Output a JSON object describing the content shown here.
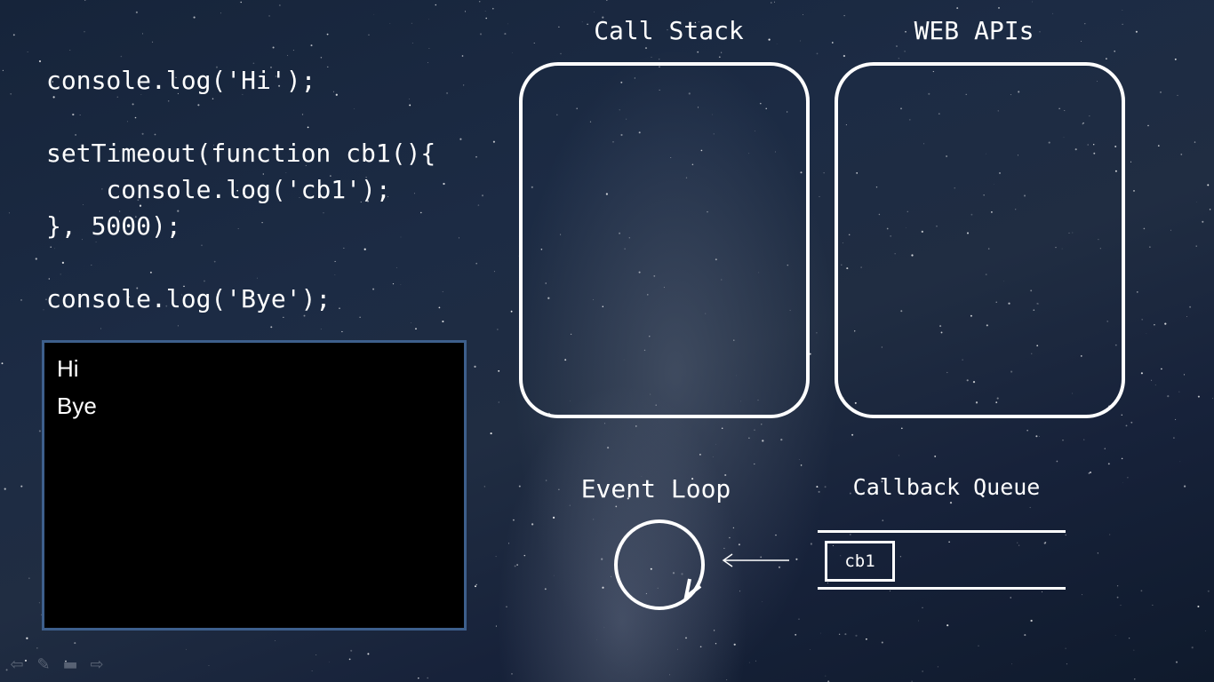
{
  "code": {
    "lines": [
      "console.log('Hi');",
      "",
      "setTimeout(function cb1(){",
      "    console.log('cb1');",
      "}, 5000);",
      "",
      "console.log('Bye');"
    ]
  },
  "console_output": [
    "Hi",
    "Bye"
  ],
  "call_stack": {
    "title": "Call Stack"
  },
  "web_apis": {
    "title": "WEB APIs"
  },
  "event_loop": {
    "title": "Event Loop"
  },
  "callback_queue": {
    "title": "Callback Queue",
    "items": [
      "cb1"
    ]
  },
  "nav": {
    "prev_icon": "arrow-left-icon",
    "pen_icon": "pen-icon",
    "menu_icon": "slide-menu-icon",
    "next_icon": "arrow-right-icon"
  },
  "colors": {
    "console_border": "#3d5f8c",
    "outline": "#ffffff"
  }
}
